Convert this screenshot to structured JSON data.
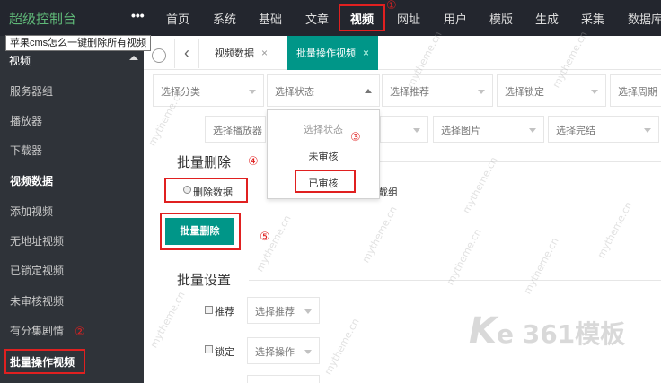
{
  "app": {
    "title": "超级控制台",
    "more": "•••"
  },
  "top_nav": [
    "首页",
    "系统",
    "基础",
    "文章",
    "视频",
    "网址",
    "用户",
    "模版",
    "生成",
    "采集",
    "数据库"
  ],
  "tooltip": "苹果cms怎么一键删除所有视频",
  "sidebar": {
    "section": "视频",
    "items": [
      "服务器组",
      "播放器",
      "下载器",
      "视频数据",
      "添加视频",
      "无地址视频",
      "已锁定视频",
      "未审核视频",
      "有分集剧情",
      "批量操作视频"
    ]
  },
  "tabs": [
    {
      "label": "视频数据",
      "close": "×"
    },
    {
      "label": "批量操作视频",
      "close": "×"
    }
  ],
  "back_arrow": "‹",
  "filters": {
    "row1": [
      "选择分类",
      "选择状态",
      "选择推荐",
      "选择锁定",
      "选择周期"
    ],
    "row2": [
      "选择播放器",
      "选择图片",
      "选择完结"
    ]
  },
  "status_dropdown": {
    "options": [
      "选择状态",
      "未审核",
      "已审核"
    ]
  },
  "batch_delete": {
    "title": "批量删除",
    "radio_delete_data": "删除数据",
    "radio_other_tail": "截组",
    "button": "批量删除"
  },
  "batch_settings": {
    "title": "批量设置",
    "recommend_label": "推荐",
    "recommend_select": "选择推荐",
    "lock_label": "锁定",
    "lock_select": "选择操作"
  },
  "annotations": {
    "n1": "①",
    "n2": "②",
    "n3": "③",
    "n4": "④",
    "n5": "⑤"
  },
  "watermarks": {
    "site": "mytheme.cn",
    "brand_k": "K",
    "brand_rest": "e 361模板"
  },
  "colors": {
    "accent": "#009688",
    "topbar": "#23262e",
    "sidebar": "#2f3339",
    "logo": "#5fb878",
    "annotation": "#e02020"
  }
}
